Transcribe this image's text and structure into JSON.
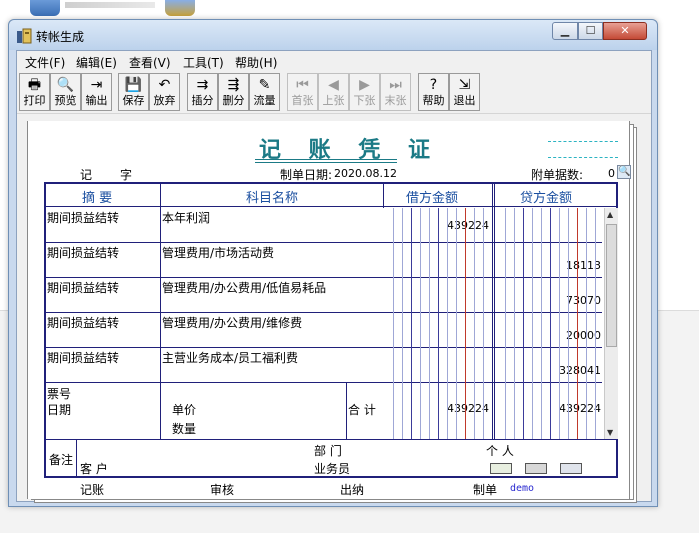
{
  "window": {
    "title": "转帐生成"
  },
  "menu": [
    "文件(F)",
    "编辑(E)",
    "查看(V)",
    "工具(T)",
    "帮助(H)"
  ],
  "toolbar": [
    {
      "label": "打印",
      "icon": "printer-icon",
      "glyph": "🖶",
      "enabled": true
    },
    {
      "label": "预览",
      "icon": "preview-icon",
      "glyph": "🔍",
      "enabled": true
    },
    {
      "label": "输出",
      "icon": "export-icon",
      "glyph": "⇥",
      "enabled": true
    },
    {
      "label": "保存",
      "icon": "save-icon",
      "glyph": "💾",
      "enabled": true
    },
    {
      "label": "放弃",
      "icon": "undo-icon",
      "glyph": "↶",
      "enabled": true
    },
    {
      "label": "插分",
      "icon": "insert-row-icon",
      "glyph": "⇉",
      "enabled": true
    },
    {
      "label": "删分",
      "icon": "delete-row-icon",
      "glyph": "⇶",
      "enabled": true
    },
    {
      "label": "流量",
      "icon": "cashflow-icon",
      "glyph": "✎",
      "enabled": true
    },
    {
      "label": "首张",
      "icon": "first-icon",
      "glyph": "⏮",
      "enabled": false
    },
    {
      "label": "上张",
      "icon": "prev-icon",
      "glyph": "◀",
      "enabled": false
    },
    {
      "label": "下张",
      "icon": "next-icon",
      "glyph": "▶",
      "enabled": false
    },
    {
      "label": "末张",
      "icon": "last-icon",
      "glyph": "⏭",
      "enabled": false
    },
    {
      "label": "帮助",
      "icon": "help-icon",
      "glyph": "?",
      "enabled": true
    },
    {
      "label": "退出",
      "icon": "exit-icon",
      "glyph": "⇲",
      "enabled": true
    }
  ],
  "voucher": {
    "title": "记 账 凭 证",
    "type_label": "记",
    "number_label": "字",
    "date_label": "制单日期:",
    "date_value": "2020.08.12",
    "attachments_label": "附单据数:",
    "attachments_value": "0",
    "columns": {
      "summary": "摘 要",
      "account": "科目名称",
      "debit": "借方金额",
      "credit": "贷方金额"
    },
    "rows": [
      {
        "summary": "期间损益结转",
        "account": "本年利润",
        "debit": "439224",
        "credit": ""
      },
      {
        "summary": "期间损益结转",
        "account": "管理费用/市场活动费",
        "debit": "",
        "credit": "18113"
      },
      {
        "summary": "期间损益结转",
        "account": "管理费用/办公费用/低值易耗品",
        "debit": "",
        "credit": "73070"
      },
      {
        "summary": "期间损益结转",
        "account": "管理费用/办公费用/维修费",
        "debit": "",
        "credit": "20000"
      },
      {
        "summary": "期间损益结转",
        "account": "主营业务成本/员工福利费",
        "debit": "",
        "credit": "328041"
      }
    ],
    "ticket_label": "票号",
    "date_field_label": "日期",
    "unit_price_label": "单价",
    "quantity_label": "数量",
    "total_label": "合 计",
    "total_debit": "439224",
    "total_credit": "439224",
    "notes_label": "备注",
    "dept_label": "部 门",
    "person_label": "个 人",
    "customer_label": "客 户",
    "salesman_label": "业务员",
    "footer": {
      "bookkeeper": "记账",
      "reviewer": "审核",
      "cashier": "出纳",
      "preparer": "制单",
      "preparer_name": "demo"
    }
  },
  "colors": {
    "grid": "#20207a",
    "title": "#1b7a86",
    "red_line": "#c0392b"
  }
}
